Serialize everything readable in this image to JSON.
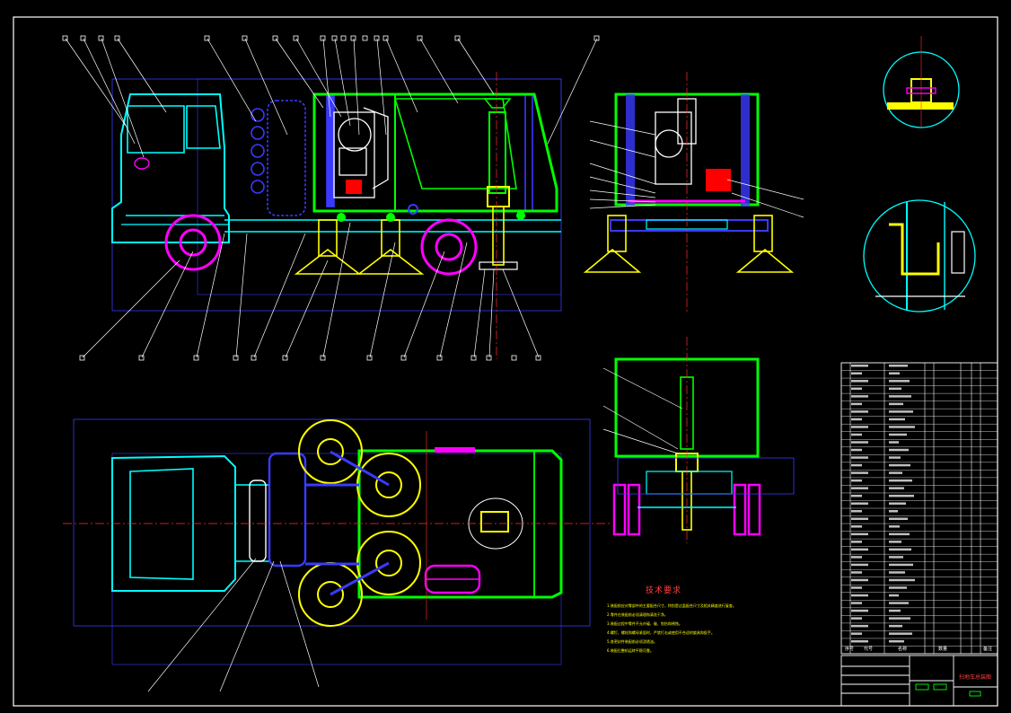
{
  "notes": {
    "title": "技术要求",
    "lines": [
      "1.装配前应对零部件的主要配合尺寸，特别是过盈配合尺寸及相关精度进行复查。",
      "2.零件在装配前必须清理和清洗干净。",
      "3.装配过程中零件不允许磕、碰、划伤和锈蚀。",
      "4.螺钉、螺栓和螺母紧固时，严禁打击或使用不合适的旋具和扳手。",
      "5.各密封件装配前必须浸透油。",
      "6.装配后整机运转平稳可靠。"
    ]
  },
  "title_block": {
    "drawing_title": "扫地车总装图",
    "header_labels": [
      "序号",
      "代号",
      "名称",
      "数量",
      "备注"
    ]
  },
  "colors": {
    "cyan": "#00ffff",
    "green": "#00ff00",
    "yellow": "#ffff00",
    "magenta": "#ff00ff",
    "red": "#ff0000",
    "blue": "#3a3aff",
    "white": "#ffffff"
  }
}
